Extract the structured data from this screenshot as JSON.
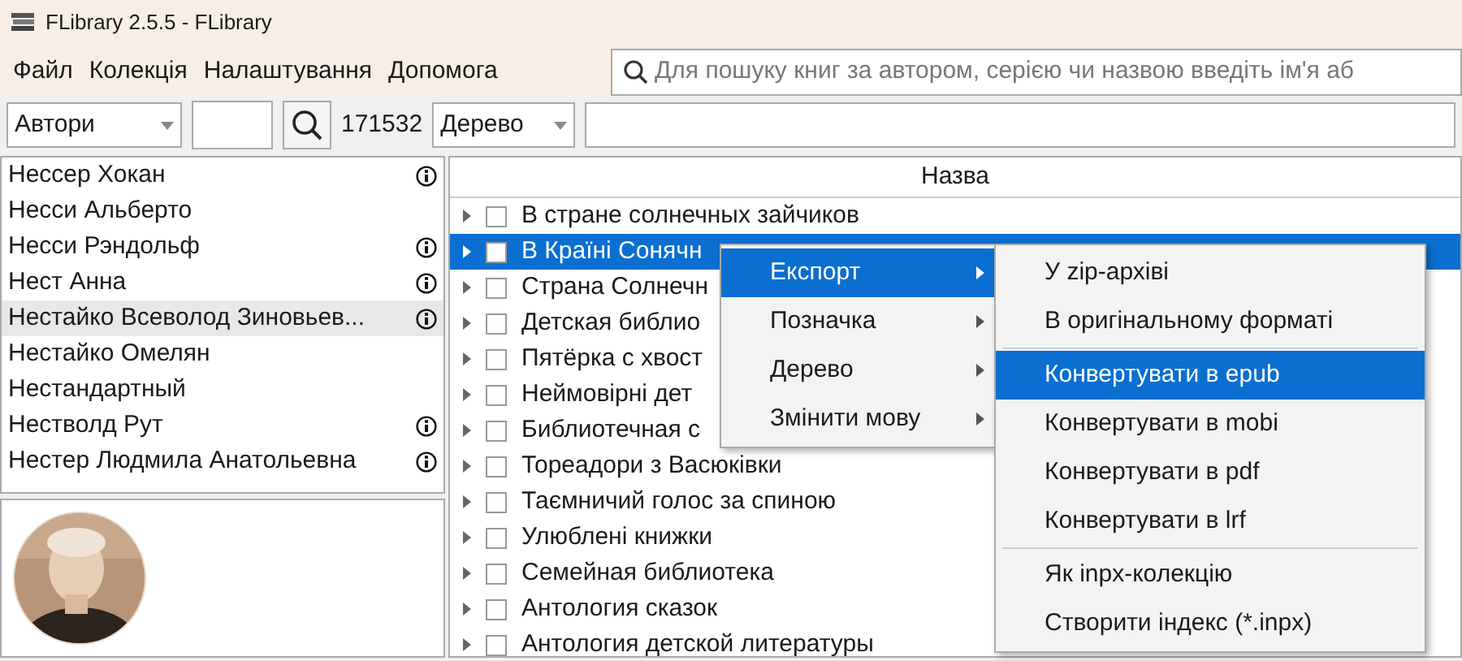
{
  "window": {
    "title": "FLibrary 2.5.5 - FLibrary"
  },
  "menu_bar": [
    "Файл",
    "Колекція",
    "Налаштування",
    "Допомога"
  ],
  "search": {
    "placeholder": "Для пошуку книг за автором, серією чи назвою введіть ім'я аб"
  },
  "toolbar": {
    "navigation_mode": "Автори",
    "count": "171532",
    "view_mode": "Дерево"
  },
  "authors": [
    {
      "name": "Нессер Хокан",
      "info": true,
      "selected": false
    },
    {
      "name": "Несси Альберто",
      "info": false,
      "selected": false
    },
    {
      "name": "Несси Рэндольф",
      "info": true,
      "selected": false
    },
    {
      "name": "Нест Анна",
      "info": true,
      "selected": false
    },
    {
      "name": "Нестайко Всеволод Зиновьев...",
      "info": true,
      "selected": true
    },
    {
      "name": "Нестайко Омелян",
      "info": false,
      "selected": false
    },
    {
      "name": "Нестандартный",
      "info": false,
      "selected": false
    },
    {
      "name": "Нестволд Рут",
      "info": true,
      "selected": false
    },
    {
      "name": "Нестер Людмила Анатольевна",
      "info": true,
      "selected": false
    }
  ],
  "book_tree": {
    "columns": [
      "Назва"
    ],
    "rows": [
      {
        "title": "В стране солнечных зайчиков",
        "checked": false,
        "selected": false
      },
      {
        "title": "В Країні Сонячн",
        "checked": false,
        "selected": true
      },
      {
        "title": "Страна Солнечн",
        "checked": false,
        "selected": false
      },
      {
        "title": "Детская библио",
        "checked": false,
        "selected": false
      },
      {
        "title": "Пятёрка с хвост",
        "checked": false,
        "selected": false
      },
      {
        "title": "Неймовірні дет",
        "checked": false,
        "selected": false
      },
      {
        "title": "Библиотечная с",
        "checked": false,
        "selected": false
      },
      {
        "title": "Тореадори з Васюківки",
        "checked": false,
        "selected": false
      },
      {
        "title": "Таємничий голос за спиною",
        "checked": false,
        "selected": false
      },
      {
        "title": "Улюблені книжки",
        "checked": false,
        "selected": false
      },
      {
        "title": "Семейная библиотека",
        "checked": false,
        "selected": false
      },
      {
        "title": "Антология сказок",
        "checked": false,
        "selected": false
      },
      {
        "title": "Антология детской литературы",
        "checked": false,
        "selected": false
      }
    ]
  },
  "context_menu": [
    {
      "label": "Експорт",
      "selected": true
    },
    {
      "label": "Позначка",
      "selected": false
    },
    {
      "label": "Дерево",
      "selected": false
    },
    {
      "label": "Змінити мову",
      "selected": false
    }
  ],
  "submenu": [
    {
      "label": "У zip-архіві",
      "selected": false,
      "separator_after": false
    },
    {
      "label": "В оригінальному форматі",
      "selected": false,
      "separator_after": true
    },
    {
      "label": "Конвертувати в epub",
      "selected": true,
      "separator_after": false
    },
    {
      "label": "Конвертувати в mobi",
      "selected": false,
      "separator_after": false
    },
    {
      "label": "Конвертувати в pdf",
      "selected": false,
      "separator_after": false
    },
    {
      "label": "Конвертувати в lrf",
      "selected": false,
      "separator_after": true
    },
    {
      "label": "Як inpx-колекцію",
      "selected": false,
      "separator_after": false
    },
    {
      "label": "Створити індекс (*.inpx)",
      "selected": false,
      "separator_after": false
    }
  ]
}
